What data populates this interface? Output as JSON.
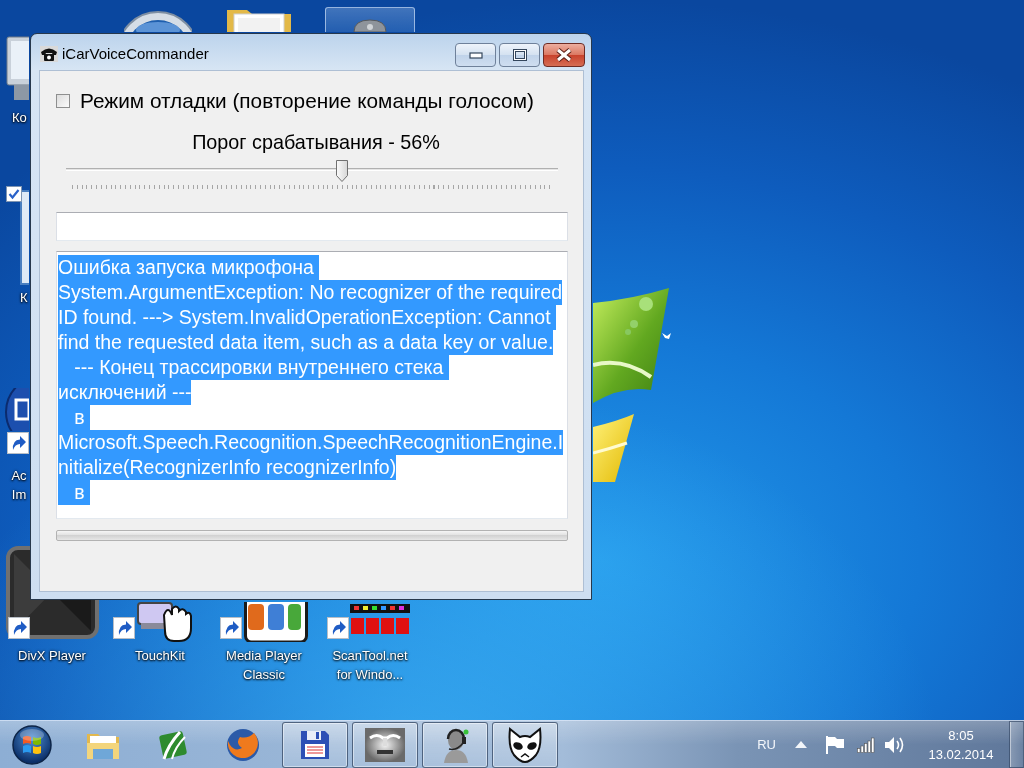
{
  "desktop": {
    "icons": [
      {
        "kind": "circle",
        "shortcut": false,
        "selected": false,
        "checked": false
      },
      {
        "kind": "folder",
        "shortcut": false,
        "selected": false,
        "checked": false
      },
      {
        "kind": "dome",
        "shortcut": false,
        "selected": true,
        "checked": false
      },
      {
        "kind": "monitor",
        "label": "Ко",
        "shortcut": false,
        "selected": false,
        "checked": false
      },
      {
        "kind": "window",
        "label": "К",
        "shortcut": false,
        "selected": false,
        "checked": true
      },
      {
        "kind": "disc",
        "label": "Ac Im",
        "shortcut": true,
        "selected": false,
        "checked": false
      },
      {
        "kind": "tile",
        "label": "DivX Player",
        "shortcut": true,
        "selected": false,
        "checked": false
      },
      {
        "kind": "hand",
        "label": "TouchKit",
        "shortcut": true,
        "selected": false,
        "checked": false
      },
      {
        "kind": "card",
        "label": "Media Player Classic",
        "shortcut": true,
        "selected": false,
        "checked": false
      },
      {
        "kind": "board",
        "label": "ScanTool.net for Windo...",
        "shortcut": true,
        "selected": false,
        "checked": false
      }
    ]
  },
  "window": {
    "title": "iCarVoiceCommander",
    "buttons": [
      {
        "kind": "minimize"
      },
      {
        "kind": "maximize"
      },
      {
        "kind": "close"
      }
    ],
    "debug_mode": {
      "label": "Режим отладки (повторение команды голосом)",
      "checked": false
    },
    "threshold": {
      "label": "Порог срабатывания - 56%",
      "level": 0.56
    },
    "log": {
      "text_selected": true,
      "lines": [
        "Ошибка запуска микрофона ",
        "System.ArgumentException: No recognizer of the required",
        "ID found. ---> System.InvalidOperationException: Cannot ",
        "find the requested data item, such as a data key or value.",
        "   --- Конец трассировки внутреннего стека ",
        "исключений ---",
        "   в ",
        "Microsoft.Speech.Recognition.SpeechRecognitionEngine.I",
        "nitialize(RecognizerInfo recognizerInfo)",
        "   в "
      ]
    }
  },
  "taskbar": {
    "items": [
      {
        "kind": "start"
      },
      {
        "kind": "folder",
        "running": false
      },
      {
        "kind": "road",
        "running": false
      },
      {
        "kind": "firefox",
        "running": false
      },
      {
        "kind": "floppy",
        "running": true
      },
      {
        "kind": "device",
        "running": true
      },
      {
        "kind": "headset",
        "running": true
      },
      {
        "kind": "alien",
        "running": true
      }
    ],
    "language": "RU",
    "tray_icons": [
      {
        "kind": "expand"
      },
      {
        "kind": "flag"
      },
      {
        "kind": "signal"
      },
      {
        "kind": "volume"
      }
    ],
    "time": "8:05",
    "date": "13.02.2014"
  }
}
